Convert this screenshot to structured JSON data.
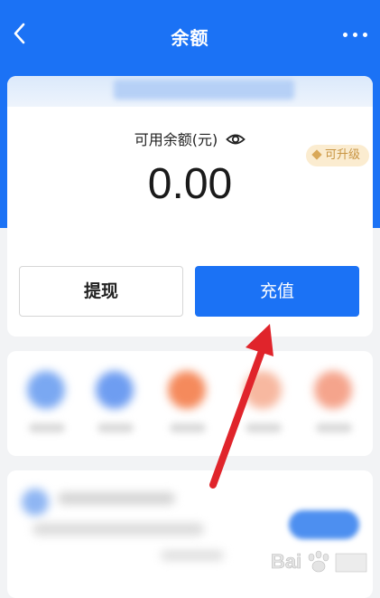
{
  "nav": {
    "title": "余额",
    "back_icon": "chevron-left-icon",
    "more_icon": "more-horizontal-icon"
  },
  "balance": {
    "label": "可用余额(元)",
    "amount": "0.00",
    "upgrade_badge": "可升级"
  },
  "actions": {
    "withdraw_label": "提现",
    "recharge_label": "充值"
  },
  "colors": {
    "primary": "#1b72f5",
    "background": "#f2f3f5",
    "badge_bg": "#fbecd0",
    "badge_text": "#c89442",
    "annotation_arrow": "#e0242b"
  }
}
